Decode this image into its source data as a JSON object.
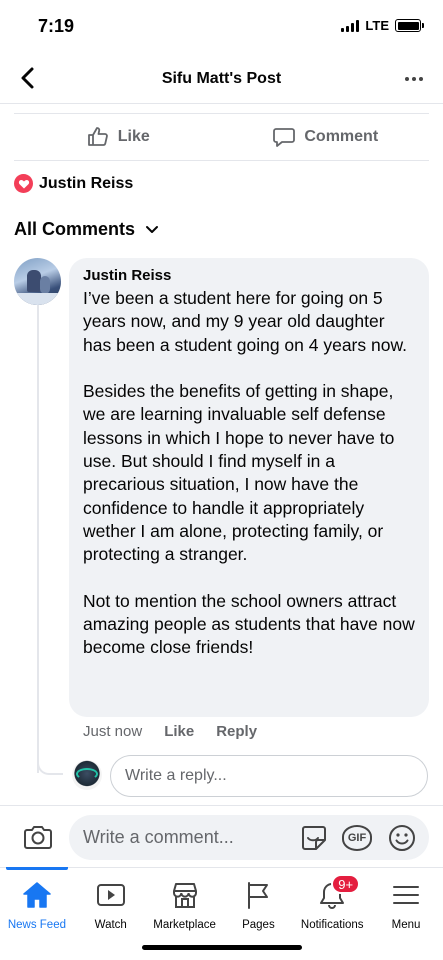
{
  "status_bar": {
    "time": "7:19",
    "network": "LTE"
  },
  "header": {
    "title": "Sifu Matt's Post",
    "back_icon": "chevron-left-icon",
    "more_icon": "more-horizontal-icon"
  },
  "actions": {
    "like_label": "Like",
    "comment_label": "Comment"
  },
  "reaction": {
    "icon": "love-reaction-icon",
    "color": "#f33e58",
    "name": "Justin Reiss"
  },
  "comments_filter": {
    "label": "All Comments"
  },
  "comment": {
    "author": "Justin Reiss",
    "text": "I’ve been a student here for going on 5 years now, and my 9 year old daughter has been a student going on 4 years now.\n\nBesides the benefits of getting in shape, we are learning invaluable self defense lessons in which I hope to never have to use. But should I find myself in a precarious situation, I now have the confidence to handle it appropriately wether I am alone, protecting family, or protecting a stranger.\n\nNot to mention the school owners attract amazing people as students that have now become close friends!",
    "time": "Just now",
    "like_label": "Like",
    "reply_label": "Reply"
  },
  "reply_composer": {
    "placeholder": "Write a reply..."
  },
  "comment_composer": {
    "placeholder": "Write a comment...",
    "gif_label": "GIF"
  },
  "bottom_nav": {
    "accent_color": "#1877f2",
    "items": [
      {
        "label": "News Feed",
        "icon": "home-icon"
      },
      {
        "label": "Watch",
        "icon": "watch-video-icon"
      },
      {
        "label": "Marketplace",
        "icon": "marketplace-shop-icon"
      },
      {
        "label": "Pages",
        "icon": "flag-icon"
      },
      {
        "label": "Notifications",
        "icon": "bell-icon",
        "badge": "9+"
      },
      {
        "label": "Menu",
        "icon": "hamburger-menu-icon"
      }
    ]
  }
}
